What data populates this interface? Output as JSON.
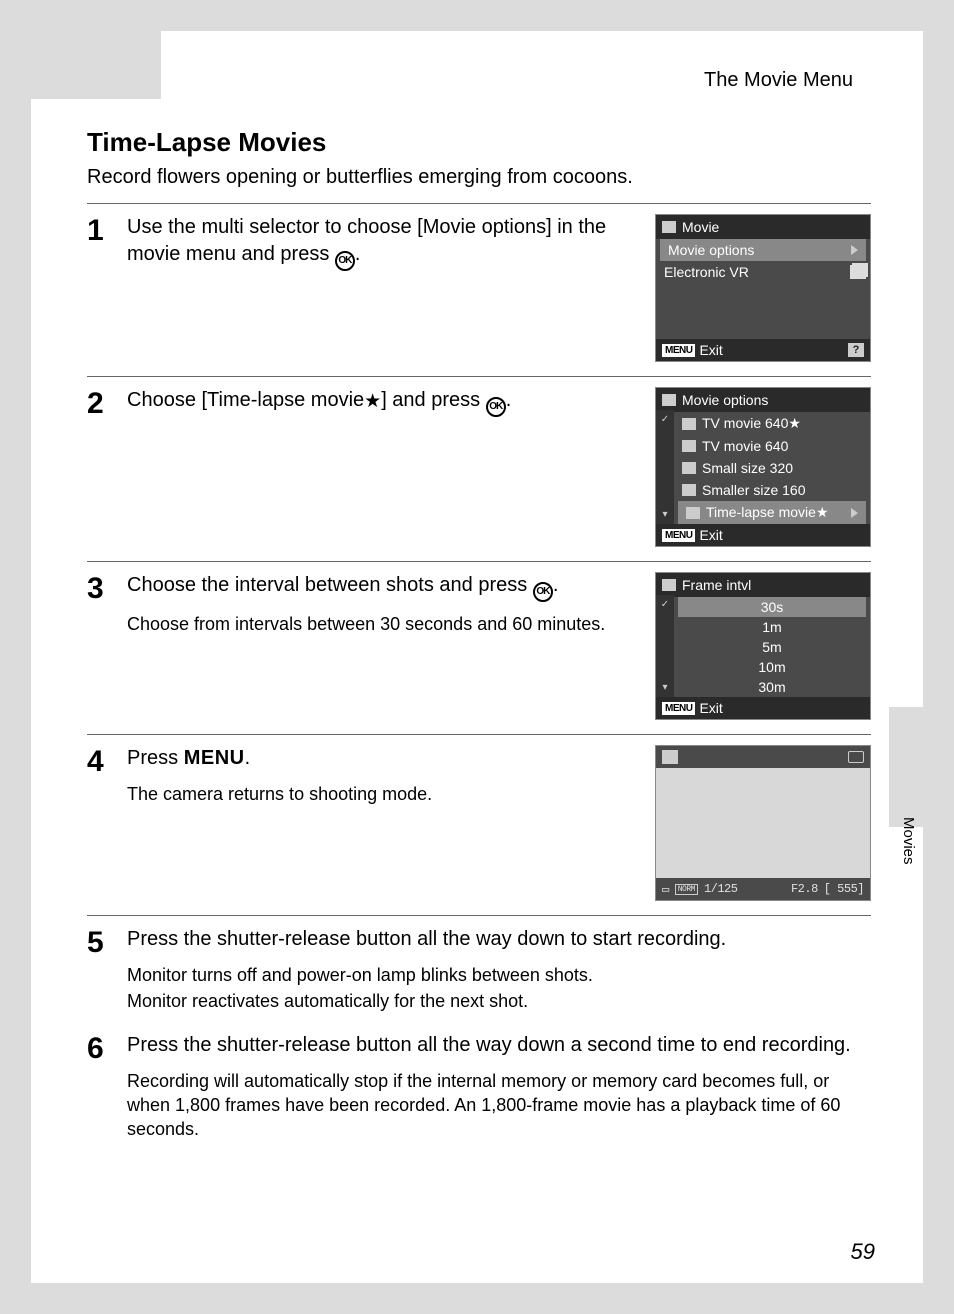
{
  "header": {
    "section": "The Movie Menu"
  },
  "title": "Time-Lapse Movies",
  "subtitle": "Record flowers opening or butterflies emerging from cocoons.",
  "side_label": "Movies",
  "page_number": "59",
  "ok_label": "OK",
  "menu_label": "MENU",
  "star": "★",
  "steps": {
    "s1": {
      "num": "1",
      "text_a": "Use the multi selector to choose [Movie options] in the movie menu and press ",
      "text_b": ".",
      "screen": {
        "title": "Movie",
        "rows": [
          "Movie options",
          "Electronic VR"
        ],
        "exit": "Exit",
        "help": "?"
      }
    },
    "s2": {
      "num": "2",
      "text_a": "Choose [Time-lapse movie",
      "text_b": "] and press ",
      "text_c": ".",
      "screen": {
        "title": "Movie options",
        "rows": [
          "TV movie 640★",
          "TV movie 640",
          "Small size 320",
          "Smaller size 160",
          "Time-lapse movie★"
        ],
        "exit": "Exit"
      }
    },
    "s3": {
      "num": "3",
      "text_a": "Choose the interval between shots and press ",
      "text_b": ".",
      "sub": "Choose from intervals between 30 seconds and 60 minutes.",
      "screen": {
        "title": "Frame intvl",
        "rows": [
          "30s",
          "1m",
          "5m",
          "10m",
          "30m"
        ],
        "exit": "Exit"
      }
    },
    "s4": {
      "num": "4",
      "text_a": "Press ",
      "text_b": ".",
      "sub": "The camera returns to shooting mode.",
      "screen": {
        "norm": "NORM",
        "shutter": "1/125",
        "aperture": "F2.8",
        "count": "[  555]"
      }
    },
    "s5": {
      "num": "5",
      "text": "Press the shutter-release button all the way down to start recording.",
      "sub1": "Monitor turns off and power-on lamp blinks between shots.",
      "sub2": "Monitor reactivates automatically for the next shot."
    },
    "s6": {
      "num": "6",
      "text": "Press the shutter-release button all the way down a second time to end recording.",
      "sub": "Recording will automatically stop if the internal memory or memory card becomes full, or when 1,800 frames have been recorded. An 1,800-frame movie has a playback time of 60 seconds."
    }
  }
}
